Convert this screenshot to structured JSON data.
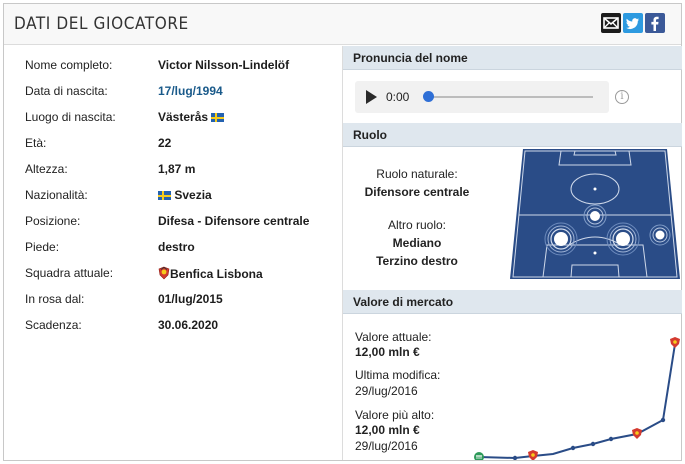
{
  "header": {
    "title": "DATI DEL GIOCATORE",
    "share": [
      {
        "icon": "mail-icon",
        "color": "#1c1c1c"
      },
      {
        "icon": "twitter-icon",
        "color": "#2d9ae0"
      },
      {
        "icon": "facebook-icon",
        "color": "#3b5998"
      }
    ]
  },
  "details": {
    "full_name": {
      "label": "Nome completo:",
      "value": "Victor Nilsson-Lindelöf"
    },
    "birth_date": {
      "label": "Data di nascita:",
      "value": "17/lug/1994"
    },
    "birth_place": {
      "label": "Luogo di nascita:",
      "value": "Västerås",
      "flag": "sweden-flag-icon"
    },
    "age": {
      "label": "Età:",
      "value": "22"
    },
    "height": {
      "label": "Altezza:",
      "value": "1,87 m"
    },
    "nationality": {
      "label": "Nazionalità:",
      "value": "Svezia",
      "flag": "sweden-flag-icon"
    },
    "position": {
      "label": "Posizione:",
      "value": "Difesa - Difensore centrale"
    },
    "foot": {
      "label": "Piede:",
      "value": "destro"
    },
    "club": {
      "label": "Squadra attuale:",
      "value": "Benfica Lisbona",
      "icon": "benfica-crest-icon"
    },
    "joined": {
      "label": "In rosa dal:",
      "value": "01/lug/2015"
    },
    "contract": {
      "label": "Scadenza:",
      "value": "30.06.2020"
    }
  },
  "pronunciation": {
    "title": "Pronuncia del nome",
    "time": "0:00",
    "progress": 0,
    "accent": "#2f6fd6"
  },
  "role": {
    "title": "Ruolo",
    "natural_label": "Ruolo naturale:",
    "natural_value": "Difensore centrale",
    "other_label": "Altro ruolo:",
    "other_values": [
      "Mediano",
      "Terzino destro"
    ],
    "pitch_color": "#2a4c87"
  },
  "market": {
    "title": "Valore di mercato",
    "current_label": "Valore attuale:",
    "current_value": "12,00 mln €",
    "last_change_label": "Ultima modifica:",
    "last_change_value": "29/lug/2016",
    "highest_label": "Valore più alto:",
    "highest_value": "12,00 mln €",
    "highest_date": "29/lug/2016",
    "chart_color": "#2a4c87"
  }
}
